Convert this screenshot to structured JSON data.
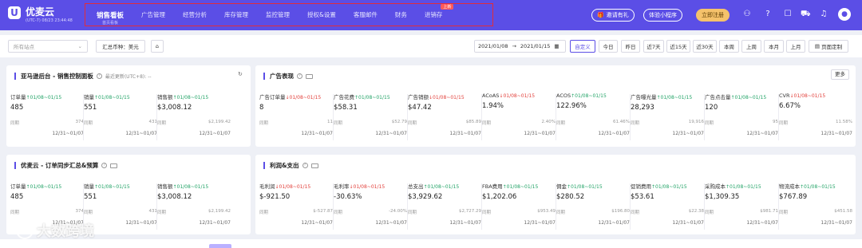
{
  "brand": {
    "name": "优麦云",
    "timezone": "(UTC-7) 08/23 23:44:48"
  },
  "nav": {
    "items": [
      {
        "label": "销售看板",
        "sub": "首页看板",
        "active": true
      },
      {
        "label": "广告管理"
      },
      {
        "label": "经营分析"
      },
      {
        "label": "库存管理"
      },
      {
        "label": "监控管理"
      },
      {
        "label": "授权&设置"
      },
      {
        "label": "客服邮件"
      },
      {
        "label": "财务"
      },
      {
        "label": "进销存",
        "badge": "上新"
      }
    ]
  },
  "top_actions": {
    "invite": "邀请有礼",
    "miniapp": "体验小程序",
    "register": "立即注册"
  },
  "icons": [
    "rocket-icon",
    "help-icon",
    "message-icon",
    "cart-icon",
    "bell-icon",
    "user-icon"
  ],
  "filters": {
    "site_placeholder": "所有站点",
    "currency_label": "汇总币种：美元",
    "date_start": "2021/01/08",
    "date_end": "2021/01/15",
    "quick": [
      "自定义",
      "今日",
      "昨日",
      "近7天",
      "近15天",
      "近30天",
      "本周",
      "上周",
      "本月",
      "上月"
    ],
    "customize": "页面定制"
  },
  "panels": {
    "amazon": {
      "title": "亚马逊后台 - 销售控制面板",
      "note": "最近更新(UTC+8): --",
      "metrics": [
        {
          "label": "订单量",
          "trend": "↑01/08~01/15",
          "dir": "up",
          "value": "485",
          "cmp_label": "同期",
          "cmp_value": "374",
          "period": "12/31~01/07"
        },
        {
          "label": "销量",
          "trend": "↑01/08~01/15",
          "dir": "up",
          "value": "551",
          "cmp_label": "同期",
          "cmp_value": "431",
          "period": "12/31~01/07"
        },
        {
          "label": "销售额",
          "trend": "↑01/08~01/15",
          "dir": "up",
          "value": "$3,008.12",
          "cmp_label": "同期",
          "cmp_value": "$2,199.42",
          "period": "12/31~01/07"
        }
      ]
    },
    "ads": {
      "title": "广告表现",
      "more": "更多",
      "metrics": [
        {
          "label": "广告订单量",
          "trend": "↓01/08~01/15",
          "dir": "down",
          "value": "8",
          "cmp_label": "同期",
          "cmp_value": "11",
          "period": "12/31~01/07"
        },
        {
          "label": "广告花费",
          "trend": "↑01/08~01/15",
          "dir": "up",
          "value": "$58.31",
          "cmp_label": "同期",
          "cmp_value": "$52.79",
          "period": "12/31~01/07"
        },
        {
          "label": "广告销额",
          "trend": "↓01/08~01/15",
          "dir": "down",
          "value": "$47.42",
          "cmp_label": "同期",
          "cmp_value": "$85.89",
          "period": "12/31~01/07"
        },
        {
          "label": "ACoAS",
          "trend": "↓01/08~01/15",
          "dir": "down",
          "value": "1.94%",
          "cmp_label": "同期",
          "cmp_value": "2.40%",
          "period": "12/31~01/07"
        },
        {
          "label": "ACOS",
          "trend": "↑01/08~01/15",
          "dir": "up",
          "value": "122.96%",
          "cmp_label": "同期",
          "cmp_value": "61.46%",
          "period": "12/31~01/07"
        },
        {
          "label": "广告曝光量",
          "trend": "↑01/08~01/15",
          "dir": "up",
          "value": "28,293",
          "cmp_label": "同期",
          "cmp_value": "19,916",
          "period": "12/31~01/07"
        },
        {
          "label": "广告点击量",
          "trend": "↑01/08~01/15",
          "dir": "up",
          "value": "120",
          "cmp_label": "同期",
          "cmp_value": "95",
          "period": "12/31~01/07"
        },
        {
          "label": "CVR",
          "trend": "↓01/08~01/15",
          "dir": "down",
          "value": "6.67%",
          "cmp_label": "同期",
          "cmp_value": "11.58%",
          "period": "12/31~01/07"
        }
      ]
    },
    "orders": {
      "title": "优麦云 - 订单同步汇总&预算",
      "metrics": [
        {
          "label": "订单量",
          "trend": "↑01/08~01/15",
          "dir": "up",
          "value": "485",
          "cmp_label": "同期",
          "cmp_value": "374",
          "period": "12/31~01/07"
        },
        {
          "label": "销量",
          "trend": "↑01/08~01/15",
          "dir": "up",
          "value": "551",
          "cmp_label": "同期",
          "cmp_value": "431",
          "period": "12/31~01/07"
        },
        {
          "label": "销售额",
          "trend": "↑01/08~01/15",
          "dir": "up",
          "value": "$3,008.12",
          "cmp_label": "同期",
          "cmp_value": "$2,199.42",
          "period": "12/31~01/07"
        }
      ]
    },
    "profit": {
      "title": "利润&支出",
      "metrics": [
        {
          "label": "毛利润",
          "trend": "↓01/08~01/15",
          "dir": "down",
          "value": "$-921.50",
          "cmp_label": "同期",
          "cmp_value": "$-527.87",
          "period": "12/31~01/07"
        },
        {
          "label": "毛利率",
          "trend": "↓01/08~01/15",
          "dir": "down",
          "value": "-30.63%",
          "cmp_label": "同期",
          "cmp_value": "-24.00%",
          "period": "12/31~01/07"
        },
        {
          "label": "总支出",
          "trend": "↑01/08~01/15",
          "dir": "up",
          "value": "$3,929.62",
          "cmp_label": "同期",
          "cmp_value": "$2,727.29",
          "period": "12/31~01/07"
        },
        {
          "label": "FBA费用",
          "trend": "↑01/08~01/15",
          "dir": "up",
          "value": "$1,202.06",
          "cmp_label": "同期",
          "cmp_value": "$953.49",
          "period": "12/31~01/07"
        },
        {
          "label": "佣金",
          "trend": "↑01/08~01/15",
          "dir": "up",
          "value": "$280.52",
          "cmp_label": "同期",
          "cmp_value": "$196.80",
          "period": "12/31~01/07"
        },
        {
          "label": "促销费用",
          "trend": "↑01/08~01/15",
          "dir": "up",
          "value": "$53.61",
          "cmp_label": "同期",
          "cmp_value": "$22.38",
          "period": "12/31~01/07"
        },
        {
          "label": "采购成本",
          "trend": "↑01/08~01/15",
          "dir": "up",
          "value": "$1,309.35",
          "cmp_label": "同期",
          "cmp_value": "$981.71",
          "period": "12/31~01/07"
        },
        {
          "label": "物流成本",
          "trend": "↑01/08~01/15",
          "dir": "up",
          "value": "$767.89",
          "cmp_label": "同期",
          "cmp_value": "$451.58",
          "period": "12/31~01/07"
        }
      ]
    }
  },
  "watermark": "大数跨境",
  "colors": {
    "primary": "#5b4ee6",
    "up": "#21a366",
    "down": "#e2413c",
    "highlight": "#e22c3a"
  }
}
